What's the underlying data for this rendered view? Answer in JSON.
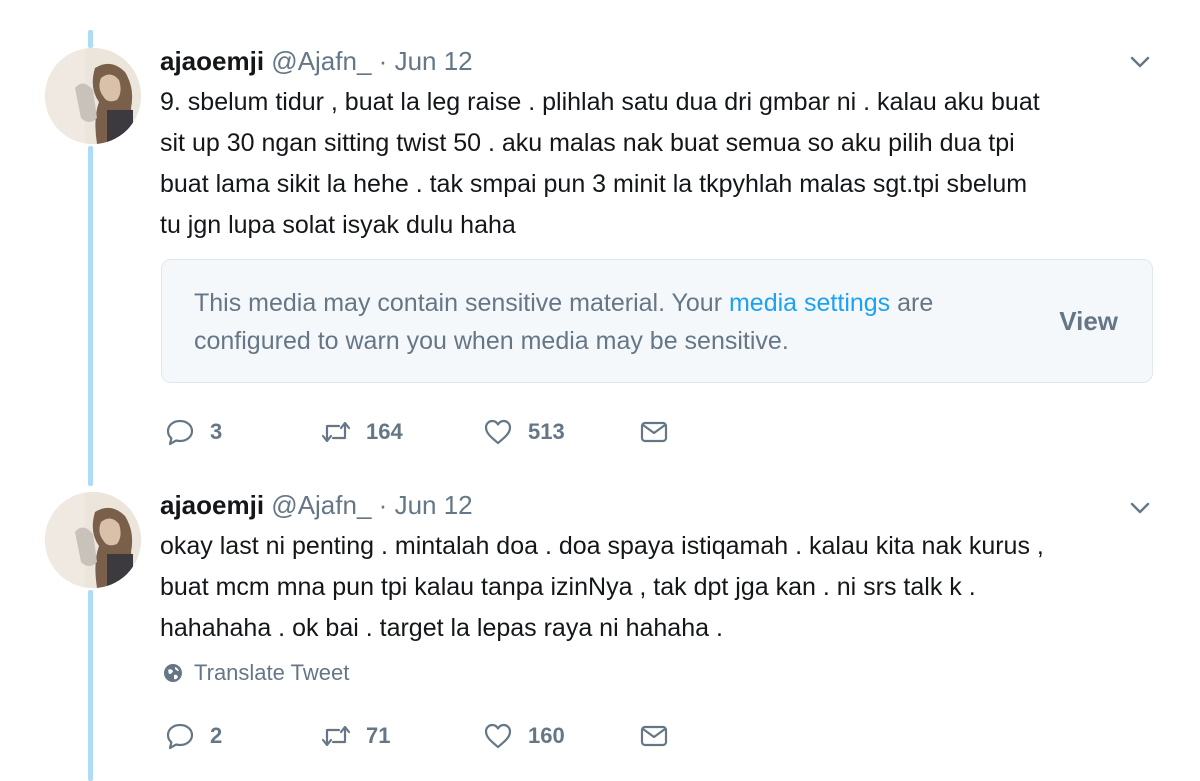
{
  "tweets": [
    {
      "display_name": "ajaoemji",
      "handle": "@Ajafn_",
      "separator": "·",
      "date": "Jun 12",
      "text": "9. sbelum tidur , buat la leg raise . plihlah satu dua dri gmbar ni . kalau aku buat\nsit up 30 ngan sitting twist 50 . aku malas nak buat semua so aku pilih dua tpi\nbuat lama sikit la hehe . tak smpai pun 3 minit la tkpyhlah malas sgt.tpi sbelum\ntu jgn lupa solat isyak dulu haha",
      "media_warning": {
        "text_before": "This media may contain sensitive material. Your ",
        "link": "media settings",
        "text_after": " are configured to warn you when media may be sensitive.",
        "view_label": "View"
      },
      "replies": "3",
      "retweets": "164",
      "likes": "513"
    },
    {
      "display_name": "ajaoemji",
      "handle": "@Ajafn_",
      "separator": "·",
      "date": "Jun 12",
      "text": "okay last ni penting . mintalah doa . doa spaya istiqamah . kalau kita nak kurus ,\nbuat mcm mna pun tpi kalau tanpa izinNya , tak dpt jga kan . ni srs talk k .\nhahahaha . ok bai . target la lepas raya ni hahaha .",
      "translate_label": "Translate Tweet",
      "replies": "2",
      "retweets": "71",
      "likes": "160"
    }
  ],
  "colors": {
    "thread_line": "#aedcf6",
    "link": "#1da1f2",
    "muted": "#657786",
    "text": "#14171a"
  }
}
